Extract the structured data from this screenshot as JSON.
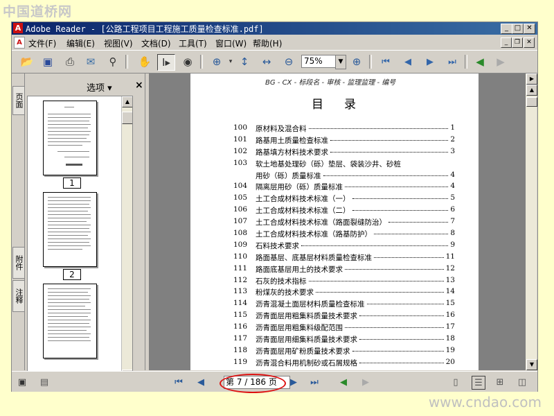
{
  "watermark": {
    "top": "中国道桥网",
    "bottom": "www.cndao.com"
  },
  "window": {
    "title": "Adobe Reader - [公路工程项目工程施工质量检查标准.pdf]",
    "app_icon": "adobe-icon"
  },
  "menu": {
    "items": [
      "文件(F)",
      "编辑(E)",
      "视图(V)",
      "文档(D)",
      "工具(T)",
      "窗口(W)",
      "帮助(H)"
    ]
  },
  "toolbar": {
    "zoom_value": "75%"
  },
  "left_panel": {
    "tabs": [
      "页面",
      "附件",
      "注释"
    ],
    "options_label": "选项 ▾",
    "close_label": "×",
    "thumbnails": [
      "1",
      "2"
    ]
  },
  "document": {
    "handwritten_header": "BG - CX - 标段名 - 审核 - 监理监理 - 编号",
    "title": "目录",
    "toc": [
      {
        "no": "100",
        "text": "原材料及混合料",
        "page": "1"
      },
      {
        "no": "101",
        "text": "路基用土质量检查标准",
        "page": "2"
      },
      {
        "no": "102",
        "text": "路基填方材料技术要求",
        "page": "3"
      },
      {
        "no": "103",
        "text": "软土地基处理砂（砾）垫层、袋装沙井、砂桩",
        "page": ""
      },
      {
        "no": "",
        "text": "用砂（砾）质量标准",
        "page": "4"
      },
      {
        "no": "104",
        "text": "隔离层用砂（砾）质量标准",
        "page": "4"
      },
      {
        "no": "105",
        "text": "土工合成材料技术标准（一）",
        "page": "5"
      },
      {
        "no": "106",
        "text": "土工合成材料技术标准（二）",
        "page": "6"
      },
      {
        "no": "107",
        "text": "土工合成材料技术标准（路面裂缝防治）",
        "page": "7"
      },
      {
        "no": "108",
        "text": "土工合成材料技术标准（路基防护）",
        "page": "8"
      },
      {
        "no": "109",
        "text": "石料技术要求",
        "page": "9"
      },
      {
        "no": "110",
        "text": "路面基层、底基层材料质量检查标准",
        "page": "11"
      },
      {
        "no": "111",
        "text": "路面底基层用土的技术要求",
        "page": "12"
      },
      {
        "no": "112",
        "text": "石灰的技术指标",
        "page": "13"
      },
      {
        "no": "113",
        "text": "粉煤灰的技术要求",
        "page": "14"
      },
      {
        "no": "114",
        "text": "沥青混凝土面层材料质量检查标准",
        "page": "15"
      },
      {
        "no": "115",
        "text": "沥青面层用粗集料质量技术要求",
        "page": "16"
      },
      {
        "no": "116",
        "text": "沥青面层用粗集料级配范围",
        "page": "17"
      },
      {
        "no": "117",
        "text": "沥青面层用细集料质量技术要求",
        "page": "18"
      },
      {
        "no": "118",
        "text": "沥青面层用矿粉质量技术要求",
        "page": "19"
      },
      {
        "no": "119",
        "text": "沥青混合料用机制砂或石屑规格",
        "page": "20"
      }
    ]
  },
  "status": {
    "page_indicator": "第 7 / 186 页"
  }
}
